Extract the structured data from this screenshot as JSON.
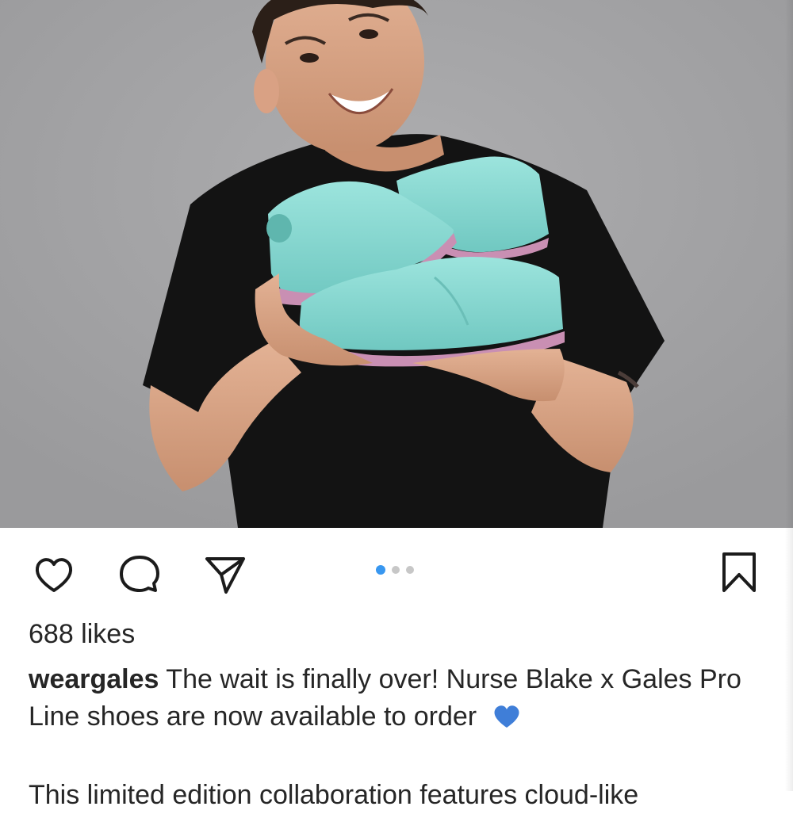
{
  "post": {
    "image_alt": "Man in black t-shirt holding teal and pink shoes",
    "carousel": {
      "total": 3,
      "active_index": 0
    },
    "actions": {
      "like": "heart-icon",
      "comment": "speech-bubble-icon",
      "share": "paper-plane-icon",
      "save": "bookmark-icon"
    },
    "likes_text": "688 likes",
    "caption": {
      "username": "weargales",
      "text": "The wait is finally over! Nurse Blake x Gales Pro Line shoes are now available to order",
      "emoji": "blue-heart",
      "continuation": "This limited edition collaboration features cloud-like"
    }
  },
  "colors": {
    "accent": "#3897f0",
    "text": "#262626",
    "dot_inactive": "#c7c7c7",
    "shoe_teal": "#86d6cf",
    "shoe_sole": "#c98fb3"
  }
}
